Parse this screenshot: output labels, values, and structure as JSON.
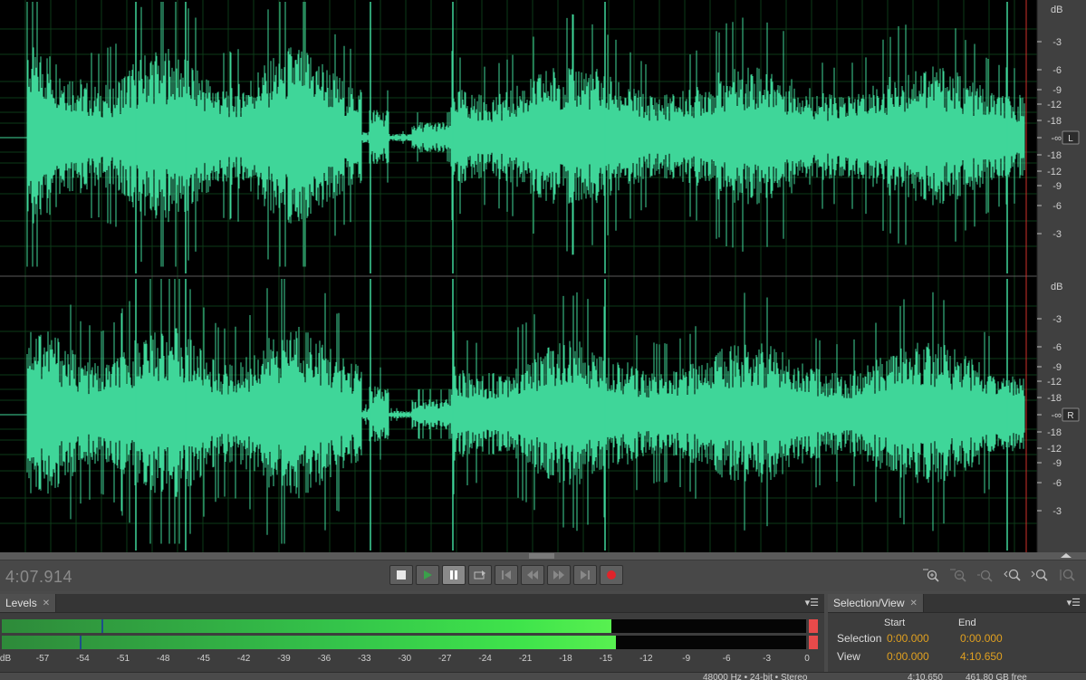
{
  "editor": {
    "channel_labels": [
      "L",
      "R"
    ],
    "amplitude_ruler": {
      "unit": "dB",
      "ticks_upper": [
        "-3",
        "-6",
        "-9",
        "-12",
        "-18"
      ],
      "center": "-∞",
      "ticks_lower": [
        "-18",
        "-12",
        "-9",
        "-6",
        "-3"
      ]
    },
    "waveform_color": "#3fd699",
    "playhead_color": "#d0302a"
  },
  "hud": {
    "time": "4:07.914"
  },
  "transport": {
    "buttons": [
      "stop",
      "play",
      "pause",
      "move-playhead",
      "skip-previous",
      "rewind",
      "fast-forward",
      "skip-next",
      "record"
    ]
  },
  "zoom": {
    "buttons": [
      "zoom-in-amplitude",
      "zoom-out-amplitude",
      "zoom-full",
      "zoom-in-time",
      "zoom-out-time",
      "zoom-selection"
    ]
  },
  "levels": {
    "tab": "Levels",
    "left_level": 0.758,
    "right_level": 0.764,
    "left_peak": 0.124,
    "right_peak": 0.097,
    "scale": [
      "dB",
      "-57",
      "-54",
      "-51",
      "-48",
      "-45",
      "-42",
      "-39",
      "-36",
      "-33",
      "-30",
      "-27",
      "-24",
      "-21",
      "-18",
      "-15",
      "-12",
      "-9",
      "-6",
      "-3",
      "0"
    ]
  },
  "selection_view": {
    "tab": "Selection/View",
    "col_start": "Start",
    "col_end": "End",
    "row_selection": "Selection",
    "row_view": "View",
    "selection_start": "0:00.000",
    "selection_end": "0:00.000",
    "view_start": "0:00.000",
    "view_end": "4:10.650"
  },
  "status": {
    "format": "48000 Hz • 24-bit • Stereo",
    "duration": "4:10.650",
    "free_space": "461.80 GB free"
  }
}
